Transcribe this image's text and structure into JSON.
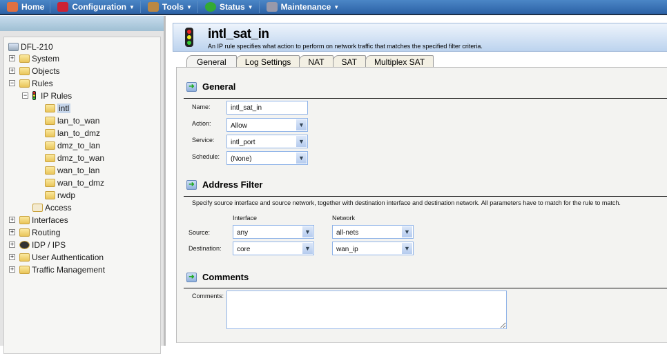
{
  "menu": [
    {
      "label": "Home",
      "icon": "home-icon",
      "color": "#e07040"
    },
    {
      "label": "Configuration",
      "icon": "configuration-icon",
      "color": "#c23"
    },
    {
      "label": "Tools",
      "icon": "tools-icon",
      "color": "#b84"
    },
    {
      "label": "Status",
      "icon": "status-icon",
      "color": "#3a3"
    },
    {
      "label": "Maintenance",
      "icon": "maintenance-icon",
      "color": "#99a"
    }
  ],
  "tree": {
    "root": "DFL-210",
    "items": [
      "System",
      "Objects",
      "Rules",
      "IP Rules",
      "intl",
      "lan_to_wan",
      "lan_to_dmz",
      "dmz_to_lan",
      "dmz_to_wan",
      "wan_to_lan",
      "wan_to_dmz",
      "rwdp",
      "Access",
      "Interfaces",
      "Routing",
      "IDP / IPS",
      "User Authentication",
      "Traffic Management"
    ],
    "selected": "intl"
  },
  "header": {
    "title": "intl_sat_in",
    "subtitle": "An IP rule specifies what action to perform on network traffic that matches the specified filter criteria."
  },
  "tabs": [
    "General",
    "Log Settings",
    "NAT",
    "SAT",
    "Multiplex SAT"
  ],
  "active_tab": "General",
  "general": {
    "heading": "General",
    "name_label": "Name:",
    "name_value": "intl_sat_in",
    "action_label": "Action:",
    "action_value": "Allow",
    "service_label": "Service:",
    "service_value": "intl_port",
    "schedule_label": "Schedule:",
    "schedule_value": "(None)"
  },
  "address_filter": {
    "heading": "Address Filter",
    "description": "Specify source interface and source network, together with destination interface and destination network. All parameters have to match for the rule to match.",
    "interface_header": "Interface",
    "network_header": "Network",
    "source_label": "Source:",
    "source_interface": "any",
    "source_network": "all-nets",
    "destination_label": "Destination:",
    "destination_interface": "core",
    "destination_network": "wan_ip"
  },
  "comments": {
    "heading": "Comments",
    "label": "Comments:",
    "value": ""
  }
}
